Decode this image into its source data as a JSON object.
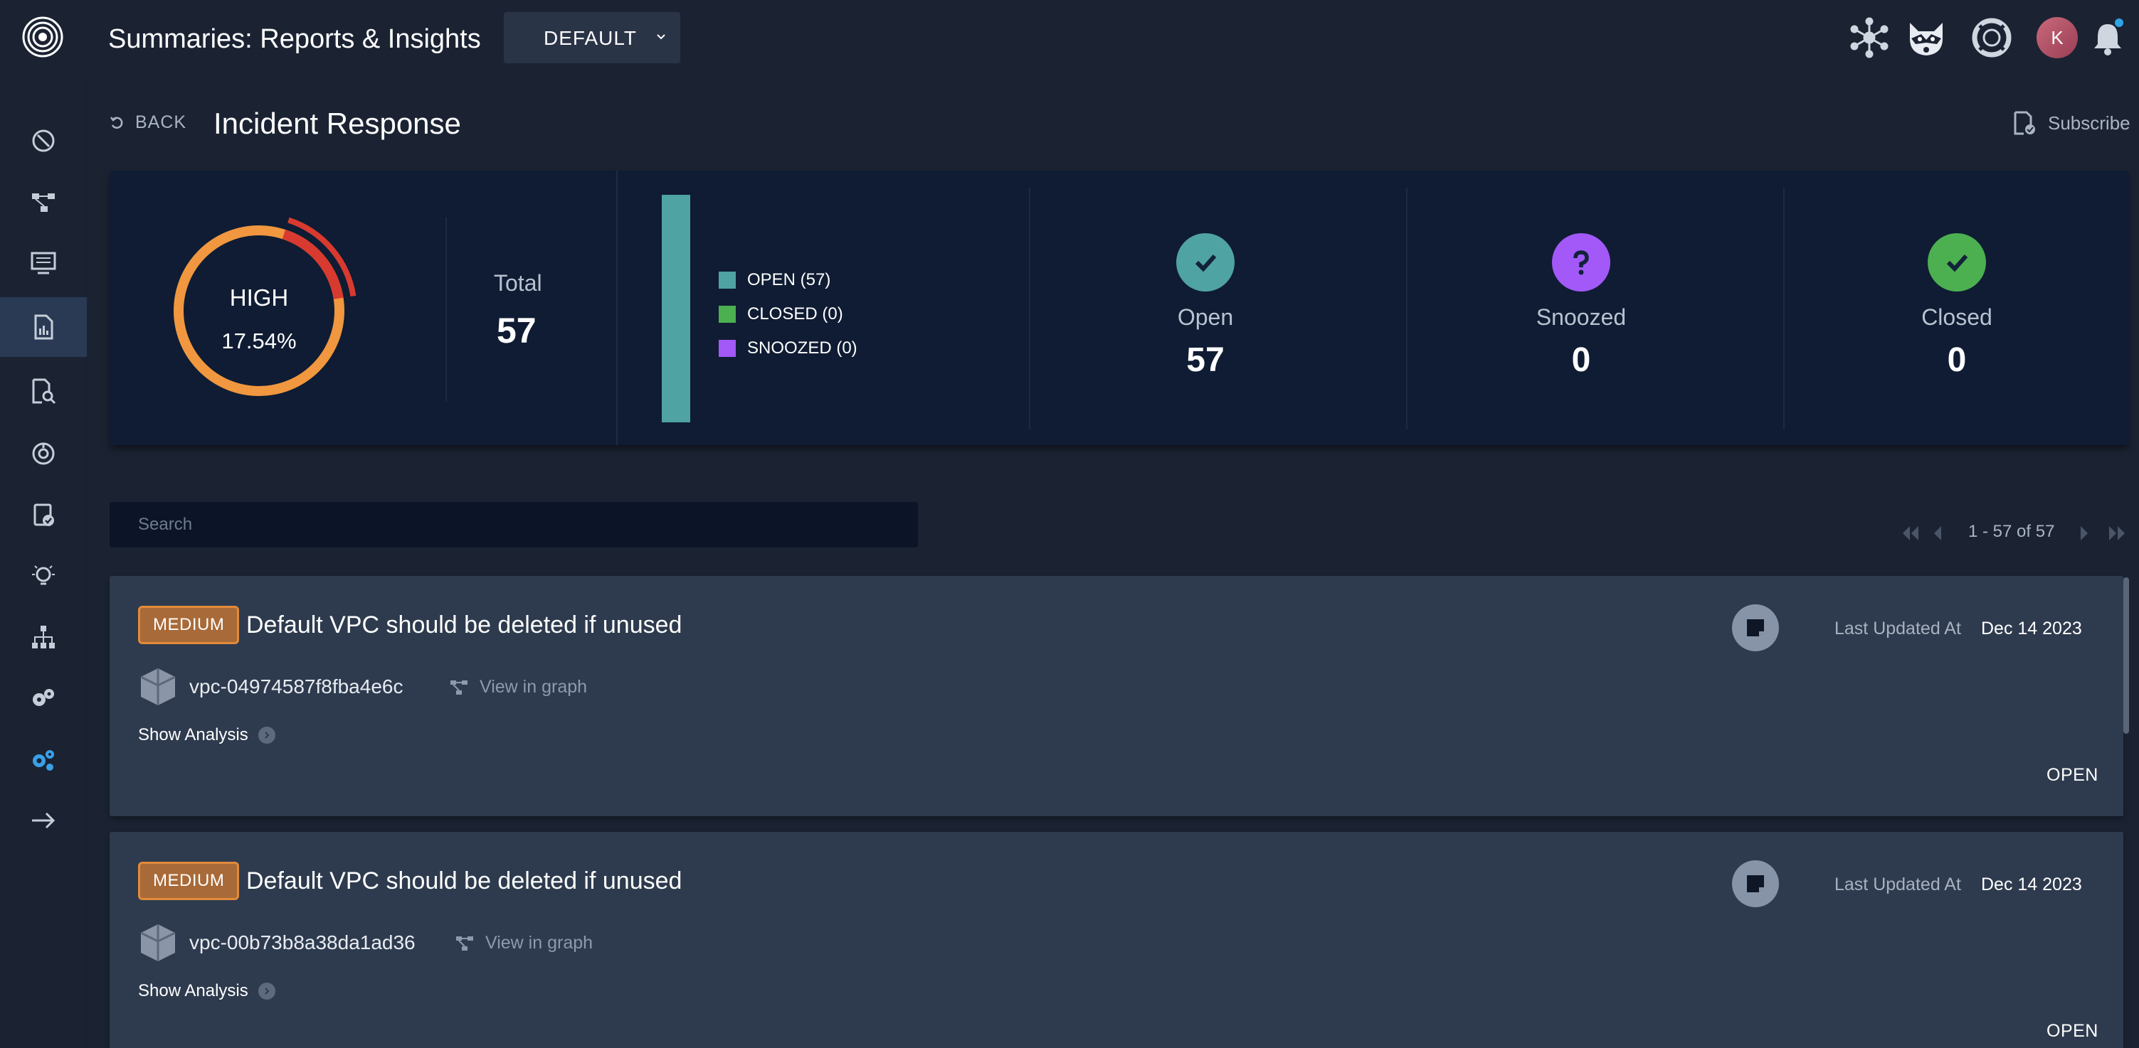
{
  "app": {
    "title": "Summaries: Reports & Insights",
    "environment": "DEFAULT",
    "avatar_initial": "K"
  },
  "header": {
    "back_label": "BACK",
    "title": "Incident Response",
    "subscribe_label": "Subscribe"
  },
  "summary": {
    "severity": "HIGH",
    "severity_percent": "17.54%",
    "total_label": "Total",
    "total_value": "57",
    "legend": [
      {
        "label": "OPEN (57)",
        "color": "#4fa3a3"
      },
      {
        "label": "CLOSED (0)",
        "color": "#4caf50"
      },
      {
        "label": "SNOOZED (0)",
        "color": "#a259f7"
      }
    ],
    "stats": [
      {
        "name": "Open",
        "value": "57",
        "color": "#4fa3a3",
        "icon": "check-icon"
      },
      {
        "name": "Snoozed",
        "value": "0",
        "color": "#a259f7",
        "icon": "question-icon"
      },
      {
        "name": "Closed",
        "value": "0",
        "color": "#4caf50",
        "icon": "check-icon"
      }
    ]
  },
  "search": {
    "placeholder": "Search"
  },
  "pagination": {
    "range": "1 - 57 of 57"
  },
  "findings": [
    {
      "severity": "MEDIUM",
      "title": "Default VPC should be deleted if unused",
      "resource_id": "vpc-04974587f8fba4e6c",
      "view_graph_label": "View in graph",
      "show_analysis_label": "Show Analysis",
      "updated_label": "Last Updated At",
      "updated_value": "Dec 14 2023",
      "status": "OPEN"
    },
    {
      "severity": "MEDIUM",
      "title": "Default VPC should be deleted if unused",
      "resource_id": "vpc-00b73b8a38da1ad36",
      "view_graph_label": "View in graph",
      "show_analysis_label": "Show Analysis",
      "updated_label": "Last Updated At",
      "updated_value": "Dec 14 2023",
      "status": "OPEN"
    }
  ],
  "colors": {
    "accent_orange": "#f0973f",
    "severity_red": "#d83a2f",
    "sidebar_active": "#2a3a55"
  }
}
